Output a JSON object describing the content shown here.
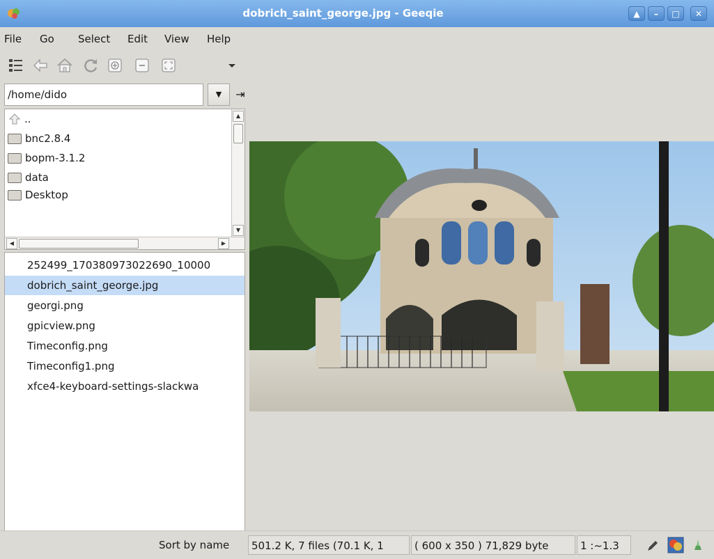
{
  "window": {
    "title": "dobrich_saint_george.jpg - Geeqie"
  },
  "menu": [
    "File",
    "Go",
    "Select",
    "Edit",
    "View",
    "Help"
  ],
  "toolbar_icons": [
    "thumbnails-list-icon",
    "back-icon",
    "home-icon",
    "refresh-icon",
    "zoom-in-icon",
    "zoom-out-icon",
    "zoom-fit-icon",
    "more-dropdown-icon"
  ],
  "path": {
    "value": "/home/dido"
  },
  "dirs": [
    {
      "label": "..",
      "icon": "up-arrow-icon"
    },
    {
      "label": "bnc2.8.4",
      "icon": "folder-icon"
    },
    {
      "label": "bopm-3.1.2",
      "icon": "folder-icon"
    },
    {
      "label": "data",
      "icon": "folder-icon"
    },
    {
      "label": "Desktop",
      "icon": "folder-icon"
    }
  ],
  "files": [
    "252499_170380973022690_10000",
    "dobrich_saint_george.jpg",
    "georgi.png",
    "gpicview.png",
    "Timeconfig.png",
    "Timeconfig1.png",
    "xfce4-keyboard-settings-slackwa"
  ],
  "selected_file_index": 1,
  "status": {
    "sort": "Sort by name",
    "files_info": "501.2 K, 7 files (70.1 K, 1",
    "image_info": "( 600 x 350 ) 71,829 byte",
    "zoom": "1 :~1.3"
  },
  "colors": {
    "titlebar": "#6aa3e2",
    "selection": "#c5dcf7",
    "background": "#dcdad5"
  }
}
